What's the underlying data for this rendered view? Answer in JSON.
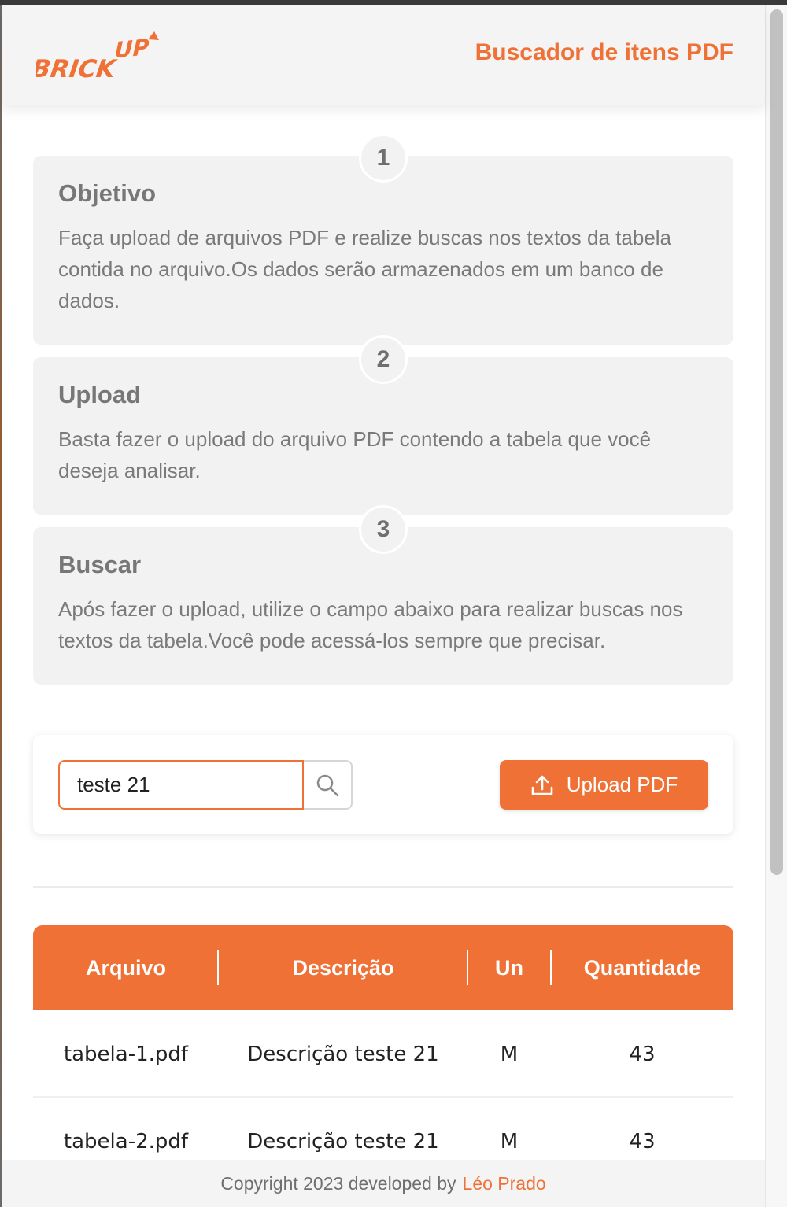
{
  "header": {
    "logo_text": "BRICK UP",
    "title": "Buscador de itens PDF"
  },
  "steps": [
    {
      "number": "1",
      "title": "Objetivo",
      "text": "Faça upload de arquivos PDF e realize buscas nos textos da tabela contida no arquivo.Os dados serão armazenados em um banco de dados."
    },
    {
      "number": "2",
      "title": "Upload",
      "text": "Basta fazer o upload do arquivo PDF contendo a tabela que você deseja analisar."
    },
    {
      "number": "3",
      "title": "Buscar",
      "text": "Após fazer o upload, utilize o campo abaixo para realizar buscas nos textos da tabela.Você pode acessá-los sempre que precisar."
    }
  ],
  "search": {
    "value": "teste 21",
    "icon": "search-icon"
  },
  "upload": {
    "label": "Upload PDF",
    "icon": "upload-icon"
  },
  "table": {
    "headers": [
      "Arquivo",
      "Descrição",
      "Un",
      "Quantidade"
    ],
    "rows": [
      [
        "tabela-1.pdf",
        "Descrição teste 21",
        "M",
        "43"
      ],
      [
        "tabela-2.pdf",
        "Descrição teste 21",
        "M",
        "43"
      ]
    ]
  },
  "footer": {
    "text": "Copyright 2023 developed by",
    "author": "Léo Prado"
  },
  "colors": {
    "accent": "#ef7136",
    "card_bg": "#f2f2f2",
    "text_muted": "#7a7a7a"
  }
}
